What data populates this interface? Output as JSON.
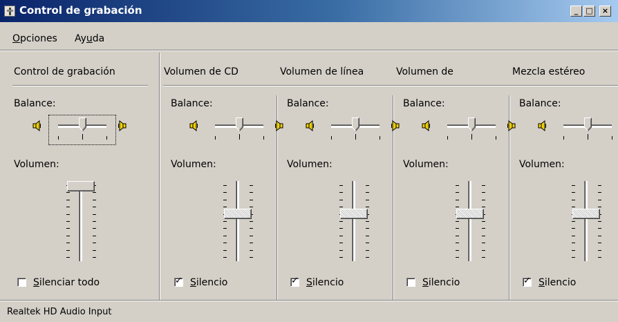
{
  "window": {
    "title": "Control de grabación",
    "title_buttons": [
      "_",
      "□",
      "×"
    ]
  },
  "menu": {
    "items": [
      {
        "label": "Opciones",
        "mnemonic": "O"
      },
      {
        "label": "Ayuda",
        "mnemonic": "u"
      }
    ]
  },
  "columns": [
    {
      "title": "Control de grabación",
      "balance_label": "Balance:",
      "volume_label": "Volumen:",
      "checkbox_label": "Silenciar todo",
      "checked": false,
      "mnemonic_index": 0,
      "balance": 0.5,
      "volume": 1.0
    },
    {
      "title": "Volumen de CD",
      "balance_label": "Balance:",
      "volume_label": "Volumen:",
      "checkbox_label": "Silencio",
      "checked": true,
      "mnemonic_index": 0,
      "balance": 0.5,
      "volume": 0.6
    },
    {
      "title": "Volumen de línea",
      "balance_label": "Balance:",
      "volume_label": "Volumen:",
      "checkbox_label": "Silencio",
      "checked": true,
      "mnemonic_index": 0,
      "balance": 0.5,
      "volume": 0.6
    },
    {
      "title": "Volumen de",
      "balance_label": "Balance:",
      "volume_label": "Volumen:",
      "checkbox_label": "Silencio",
      "checked": false,
      "mnemonic_index": 0,
      "balance": 0.5,
      "volume": 0.6
    },
    {
      "title": "Mezcla estéreo",
      "balance_label": "Balance:",
      "volume_label": "Volumen:",
      "checkbox_label": "Silencio",
      "checked": true,
      "mnemonic_index": 0,
      "balance": 0.5,
      "volume": 0.6
    }
  ],
  "status": {
    "text": "Realtek HD Audio Input"
  },
  "colors": {
    "face": "#d4d0c8",
    "title_start": "#0a246a",
    "title_end": "#a6caf0",
    "speaker": "#f0d000"
  }
}
